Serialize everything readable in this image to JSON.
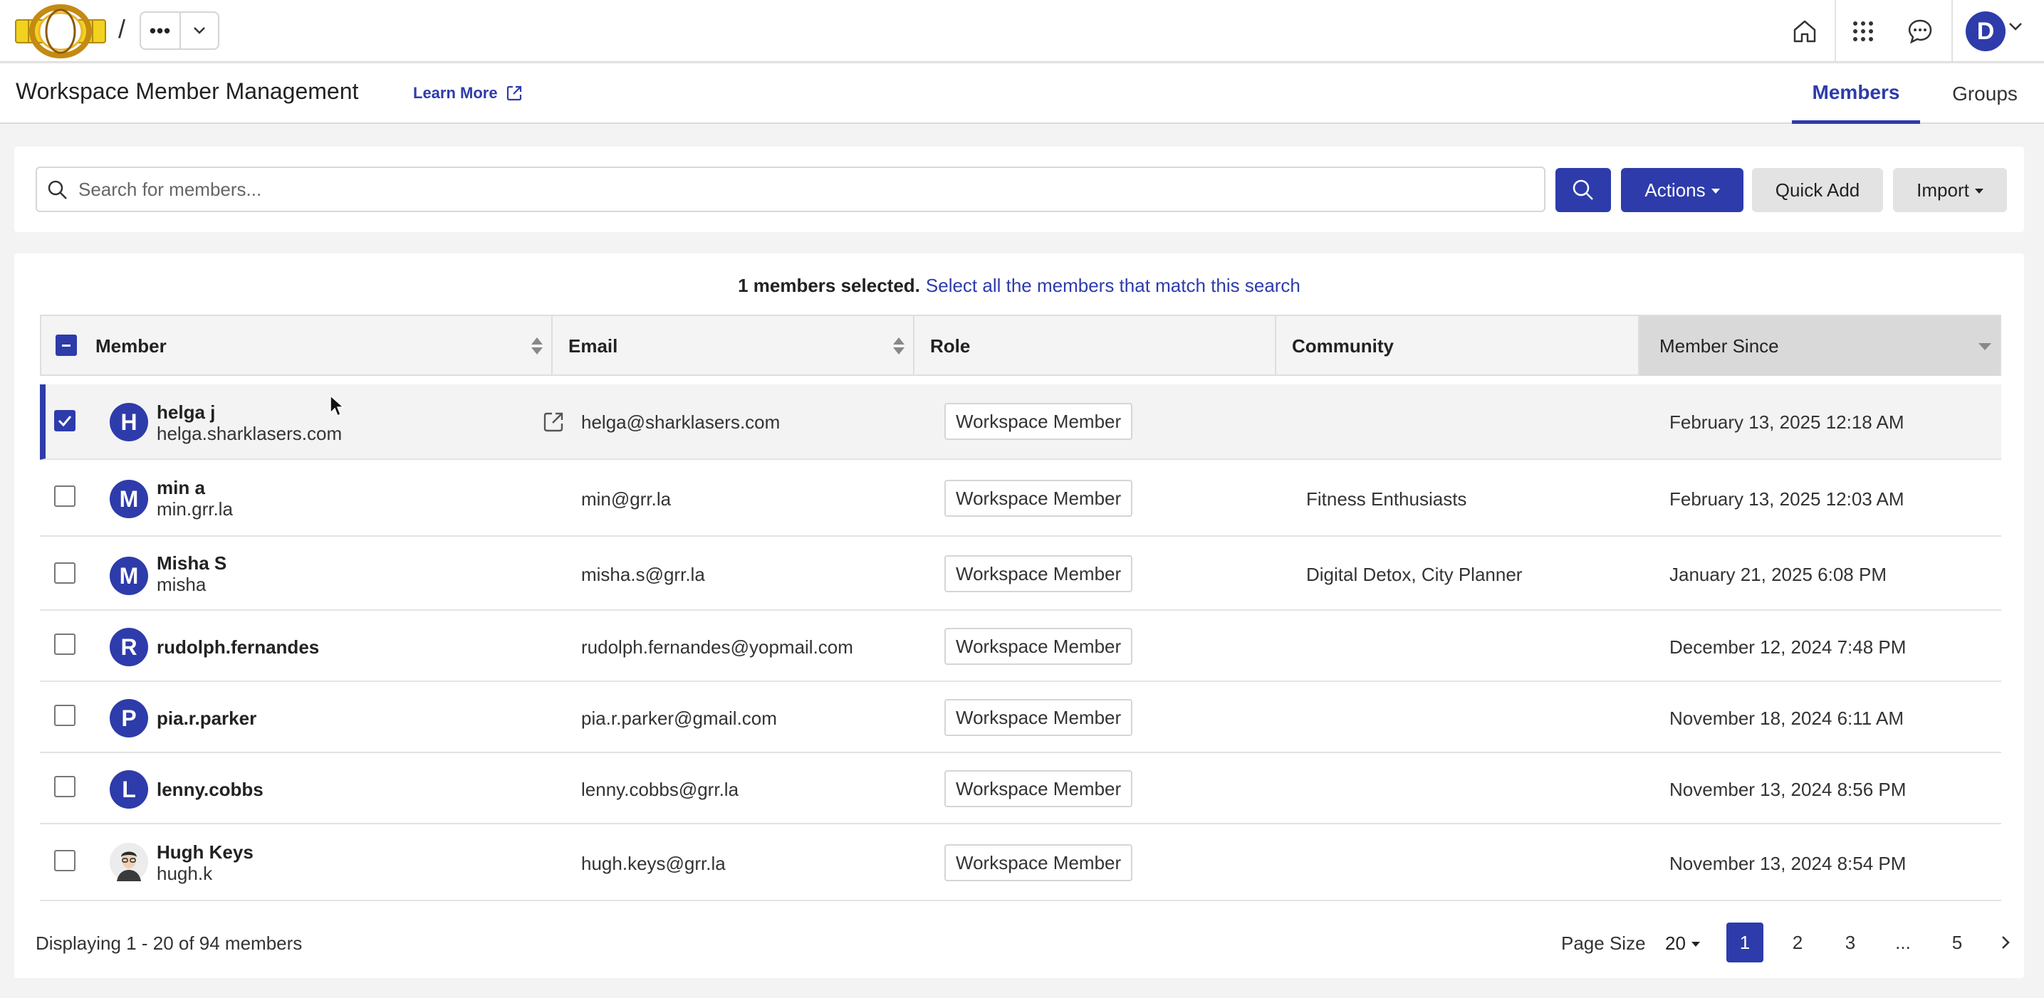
{
  "topbar": {
    "crumb_slash": "/",
    "crumb_more": "•••",
    "user_initial": "D"
  },
  "header": {
    "title": "Workspace Member Management",
    "learn_more": "Learn More",
    "tabs": [
      {
        "label": "Members",
        "active": true
      },
      {
        "label": "Groups",
        "active": false
      }
    ]
  },
  "search": {
    "placeholder": "Search for members...",
    "actions_label": "Actions",
    "quick_add_label": "Quick Add",
    "import_label": "Import"
  },
  "selection": {
    "count_text": "1 members selected.",
    "select_all_link": "Select all the members that match this search"
  },
  "table": {
    "columns": [
      "Member",
      "Email",
      "Role",
      "Community",
      "Member Since"
    ],
    "rows": [
      {
        "initial": "H",
        "name": "helga j",
        "sub": "helga.sharklasers.com",
        "email": "helga@sharklasers.com",
        "role": "Workspace Member",
        "community": "",
        "since": "February 13, 2025 12:18 AM",
        "checked": true
      },
      {
        "initial": "M",
        "name": "min a",
        "sub": "min.grr.la",
        "email": "min@grr.la",
        "role": "Workspace Member",
        "community": "Fitness Enthusiasts",
        "since": "February 13, 2025 12:03 AM",
        "checked": false
      },
      {
        "initial": "M",
        "name": "Misha S",
        "sub": "misha",
        "email": "misha.s@grr.la",
        "role": "Workspace Member",
        "community": "Digital Detox, City Planner",
        "since": "January 21, 2025 6:08 PM",
        "checked": false
      },
      {
        "initial": "R",
        "name": "rudolph.fernandes",
        "sub": "",
        "email": "rudolph.fernandes@yopmail.com",
        "role": "Workspace Member",
        "community": "",
        "since": "December 12, 2024 7:48 PM",
        "checked": false
      },
      {
        "initial": "P",
        "name": "pia.r.parker",
        "sub": "",
        "email": "pia.r.parker@gmail.com",
        "role": "Workspace Member",
        "community": "",
        "since": "November 18, 2024 6:11 AM",
        "checked": false
      },
      {
        "initial": "L",
        "name": "lenny.cobbs",
        "sub": "",
        "email": "lenny.cobbs@grr.la",
        "role": "Workspace Member",
        "community": "",
        "since": "November 13, 2024 8:56 PM",
        "checked": false
      },
      {
        "initial": "",
        "name": "Hugh Keys",
        "sub": "hugh.k",
        "email": "hugh.keys@grr.la",
        "role": "Workspace Member",
        "community": "",
        "since": "November 13, 2024 8:54 PM",
        "checked": false
      }
    ]
  },
  "footer": {
    "displaying": "Displaying 1 - 20 of 94 members",
    "page_size_label": "Page Size",
    "page_size_value": "20",
    "pages": [
      "1",
      "2",
      "3",
      "...",
      "5"
    ],
    "current_page": "1"
  },
  "colors": {
    "accent": "#2e3bab",
    "selected_row_bg": "#f3f3f3"
  },
  "icons": {
    "home": "home-icon",
    "apps": "apps-grid-icon",
    "chat": "chat-icon",
    "search": "search-icon",
    "external": "external-link-icon",
    "next": "chevron-right-icon"
  }
}
